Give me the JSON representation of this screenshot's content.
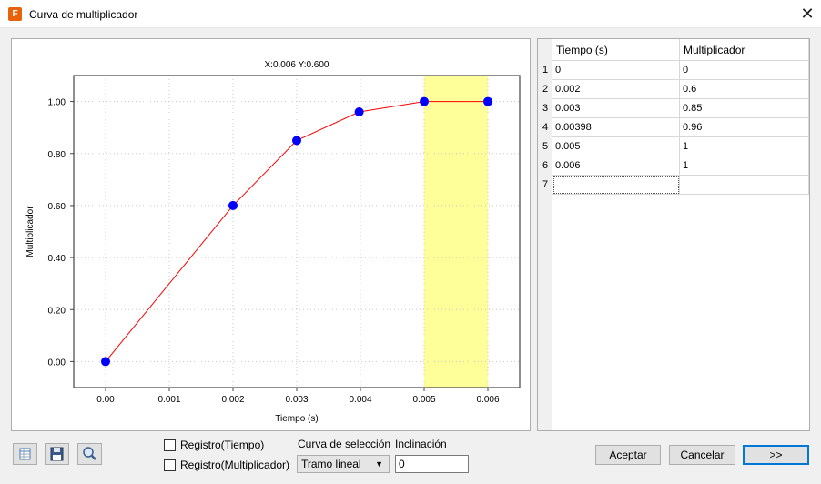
{
  "window": {
    "title": "Curva de multiplicador",
    "app_icon_letter": "F",
    "close_glyph": "✕"
  },
  "chart_data": {
    "type": "line",
    "title": "",
    "readout": "X:0.006 Y:0.600",
    "xlabel": "Tiempo (s)",
    "ylabel": "Multiplicador",
    "xlim": [
      -0.0005,
      0.0065
    ],
    "ylim": [
      -0.1,
      1.1
    ],
    "x_ticks": [
      "0.00",
      "0.001",
      "0.002",
      "0.003",
      "0.004",
      "0.005",
      "0.006"
    ],
    "y_ticks": [
      "0.00",
      "0.20",
      "0.40",
      "0.60",
      "0.80",
      "1.00"
    ],
    "x": [
      0,
      0.002,
      0.003,
      0.00398,
      0.005,
      0.006
    ],
    "y": [
      0,
      0.6,
      0.85,
      0.96,
      1,
      1
    ],
    "highlight_range": [
      0.005,
      0.006
    ],
    "grid": true,
    "colors": {
      "line": "#ff0000",
      "marker": "#0000ff",
      "highlight": "#ffff99"
    }
  },
  "table": {
    "columns": [
      "Tiempo (s)",
      "Multiplicador"
    ],
    "rows": [
      {
        "num": "1",
        "tiempo": "0",
        "mult": "0"
      },
      {
        "num": "2",
        "tiempo": "0.002",
        "mult": "0.6"
      },
      {
        "num": "3",
        "tiempo": "0.003",
        "mult": "0.85"
      },
      {
        "num": "4",
        "tiempo": "0.00398",
        "mult": "0.96"
      },
      {
        "num": "5",
        "tiempo": "0.005",
        "mult": "1"
      },
      {
        "num": "6",
        "tiempo": "0.006",
        "mult": "1"
      },
      {
        "num": "7",
        "tiempo": "",
        "mult": ""
      }
    ]
  },
  "toolbar": {
    "icons": [
      "edit-table-icon",
      "save-icon",
      "zoom-icon"
    ]
  },
  "options": {
    "log_time_label": "Registro(Tiempo)",
    "log_mult_label": "Registro(Multiplicador)",
    "curve_label": "Curva de selección",
    "curve_value": "Tramo lineal",
    "slope_label": "Inclinación",
    "slope_value": "0"
  },
  "buttons": {
    "accept": "Aceptar",
    "cancel": "Cancelar",
    "next": ">>"
  }
}
